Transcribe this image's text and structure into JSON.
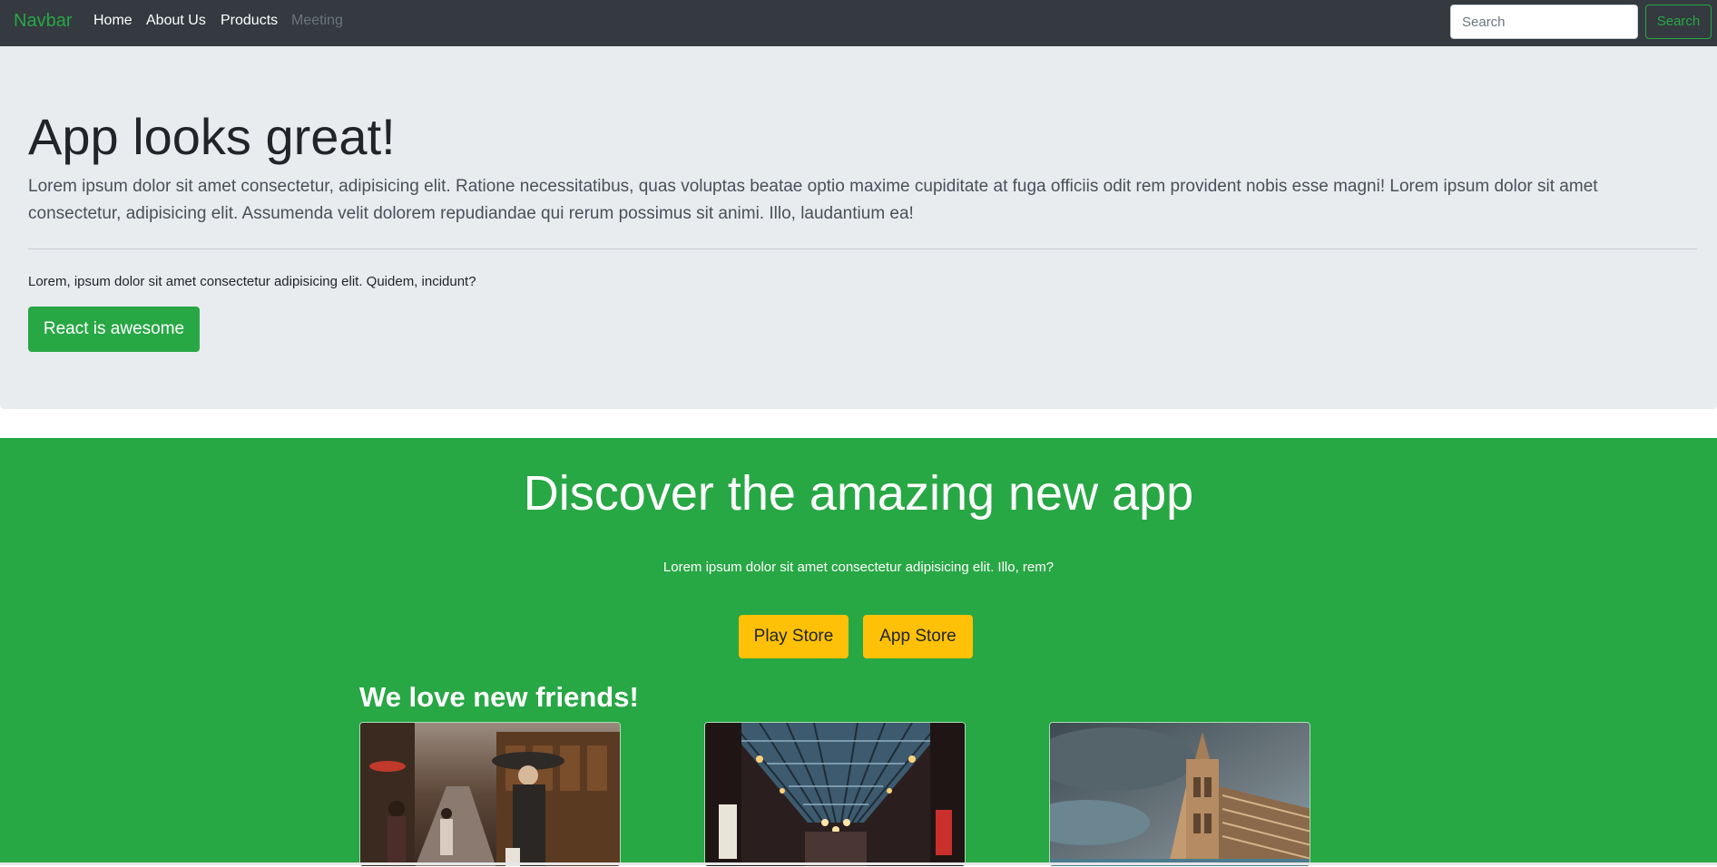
{
  "navbar": {
    "brand": "Navbar",
    "links": [
      {
        "label": "Home"
      },
      {
        "label": "About Us"
      },
      {
        "label": "Products"
      },
      {
        "label": "Meeting",
        "disabled": true
      }
    ],
    "search": {
      "placeholder": "Search",
      "value": "",
      "button_label": "Search"
    },
    "colors": {
      "background": "#343a40",
      "brand": "#28a745"
    }
  },
  "jumbotron": {
    "title": "App looks great!",
    "lead": "Lorem ipsum dolor sit amet consectetur, adipisicing elit. Ratione necessitatibus, quas voluptas beatae optio maxime cupiditate at fuga officiis odit rem provident nobis esse magni! Lorem ipsum dolor sit amet consectetur, adipisicing elit. Assumenda velit dolorem repudiandae qui rerum possimus sit animi. Illo, laudantium ea!",
    "text": "Lorem, ipsum dolor sit amet consectetur adipisicing elit. Quidem, incidunt?",
    "button_label": "React is awesome"
  },
  "discover": {
    "title": "Discover the amazing new app",
    "text": "Lorem ipsum dolor sit amet consectetur adipisicing elit. Illo, rem?",
    "buttons": [
      {
        "label": "Play Store"
      },
      {
        "label": "App Store"
      }
    ],
    "friends_title": "We love new friends!",
    "cards": [
      {
        "image": "street-photo"
      },
      {
        "image": "arcade-photo"
      },
      {
        "image": "cathedral-photo"
      }
    ],
    "colors": {
      "background": "#28a745",
      "button": "#ffc107"
    }
  }
}
